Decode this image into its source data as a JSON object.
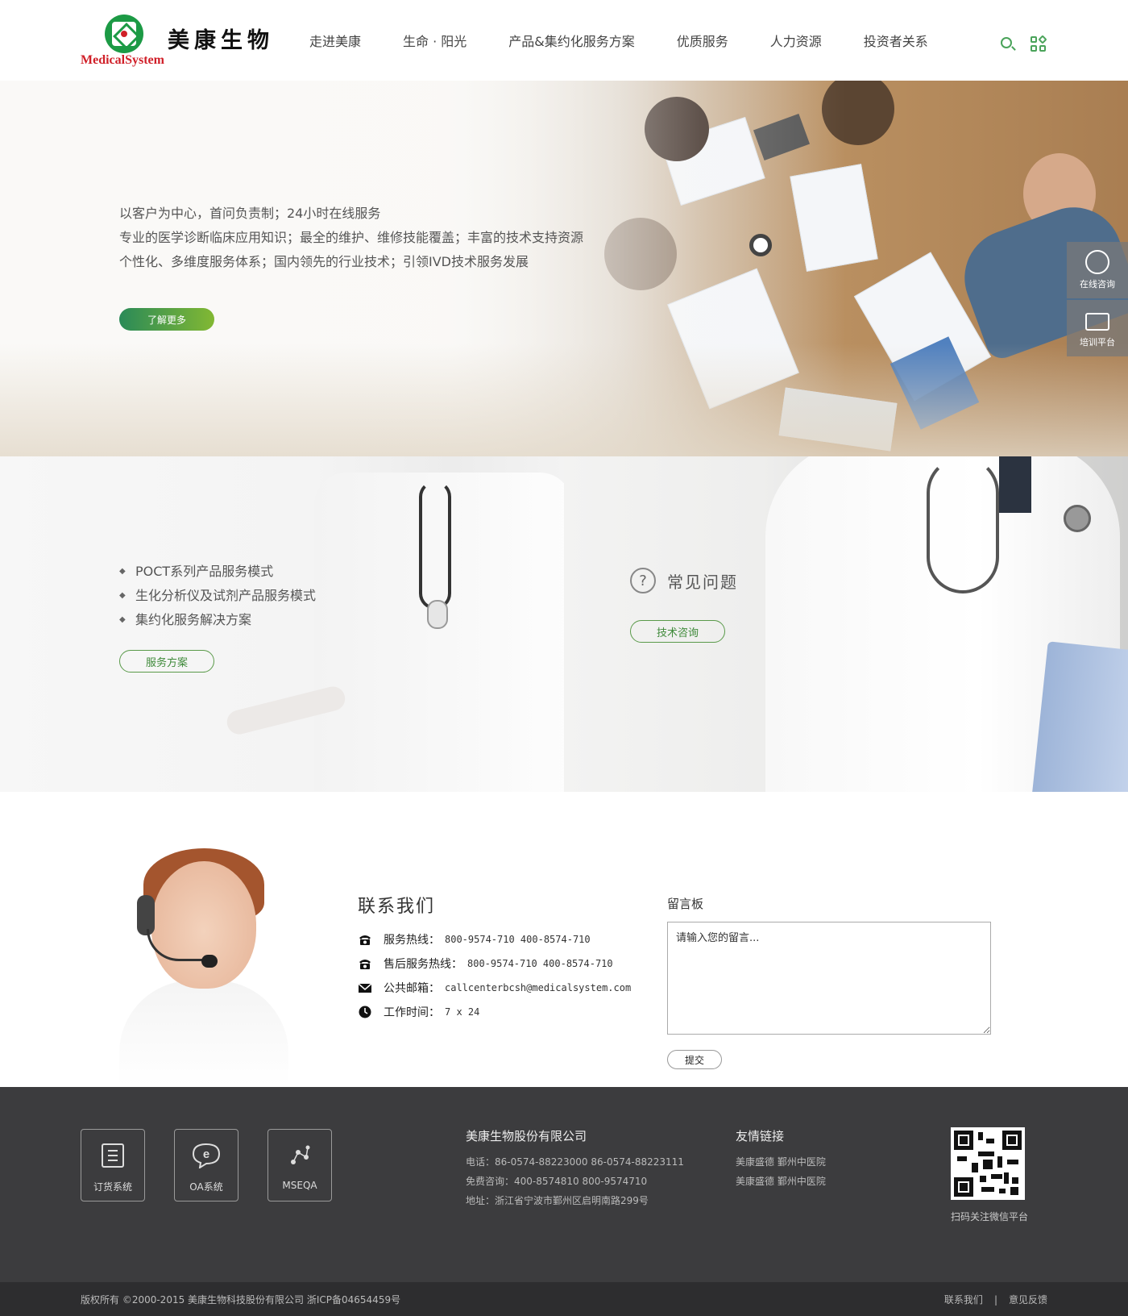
{
  "brand": {
    "name_cn": "美康生物",
    "name_en": "MedicalSystem",
    "colors": {
      "green": "#1c9a45",
      "red": "#d01f28",
      "accent": "#4aa35a"
    }
  },
  "nav": {
    "items": [
      "走进美康",
      "生命 · 阳光",
      "产品&集约化服务方案",
      "优质服务",
      "人力资源",
      "投资者关系"
    ],
    "icons": [
      "search-icon",
      "apps-icon"
    ]
  },
  "hero": {
    "lines": [
      "以客户为中心，首问负责制；24小时在线服务",
      "专业的医学诊断临床应用知识；最全的维护、维修技能覆盖；丰富的技术支持资源",
      "个性化、多维度服务体系；国内领先的行业技术；引领IVD技术服务发展"
    ],
    "button": "了解更多"
  },
  "side": {
    "items": [
      {
        "label": "在线咨询",
        "icon": "chat-icon"
      },
      {
        "label": "培训平台",
        "icon": "training-icon"
      }
    ]
  },
  "solutions": {
    "bullets": [
      "POCT系列产品服务模式",
      "生化分析仪及试剂产品服务模式",
      "集约化服务解决方案"
    ],
    "button": "服务方案"
  },
  "faq": {
    "icon": "?",
    "title": "常见问题",
    "button": "技术咨询"
  },
  "contact": {
    "title": "联系我们",
    "rows": [
      {
        "icon": "phone-icon",
        "label": "服务热线：",
        "value": "800-9574-710 400-8574-710"
      },
      {
        "icon": "phone-icon",
        "label": "售后服务热线：",
        "value": "800-9574-710 400-8574-710"
      },
      {
        "icon": "mail-icon",
        "label": "公共邮箱：",
        "value": "callcenterbcsh@medicalsystem.com"
      },
      {
        "icon": "clock-icon",
        "label": "工作时间：",
        "value": "7 x 24"
      }
    ],
    "message": {
      "title": "留言板",
      "placeholder": "请输入您的留言...",
      "submit": "提交"
    }
  },
  "footer": {
    "systems": [
      {
        "label": "订货系统",
        "icon": "order-icon"
      },
      {
        "label": "OA系统",
        "icon": "oa-icon"
      },
      {
        "label": "MSEQA",
        "icon": "network-icon"
      }
    ],
    "company": {
      "name": "美康生物股份有限公司",
      "phone": "电话：86-0574-88223000  86-0574-88223111",
      "hotline": "免费咨询：400-8574810  800-9574710",
      "address": "地址：浙江省宁波市鄞州区启明南路299号"
    },
    "links": {
      "title": "友情链接",
      "items": [
        "美康盛德   鄞州中医院",
        "美康盛德   鄞州中医院"
      ]
    },
    "qr_caption": "扫码关注微信平台",
    "copyright": "版权所有 ©2000-2015  美康生物科技股份有限公司  浙ICP备04654459号",
    "bottom_links": [
      "联系我们",
      "意见反馈"
    ],
    "bottom_sep": "|"
  }
}
